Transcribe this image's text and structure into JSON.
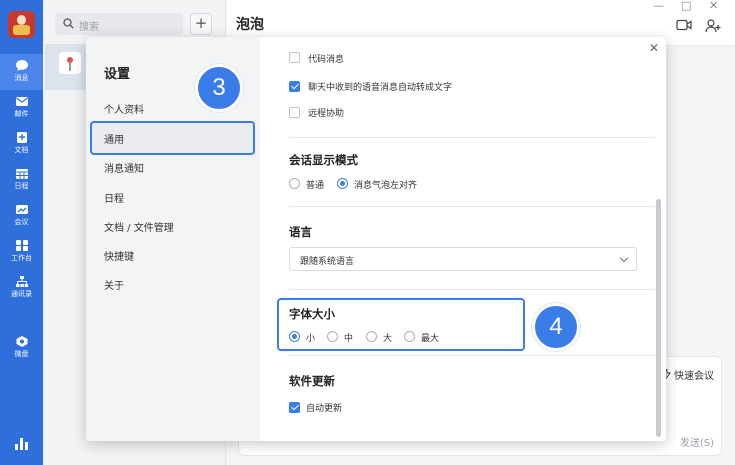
{
  "nav": {
    "items": [
      {
        "label": "消息",
        "icon": "chat-bubble-icon"
      },
      {
        "label": "邮件",
        "icon": "mail-icon"
      },
      {
        "label": "文档",
        "icon": "document-icon"
      },
      {
        "label": "日程",
        "icon": "calendar-icon"
      },
      {
        "label": "会议",
        "icon": "meeting-icon"
      },
      {
        "label": "工作台",
        "icon": "workbench-icon"
      },
      {
        "label": "通讯录",
        "icon": "contacts-icon"
      },
      {
        "label": "微盘",
        "icon": "drive-icon"
      }
    ]
  },
  "search": {
    "placeholder": "搜索"
  },
  "chat": {
    "title": "泡泡"
  },
  "compose": {
    "quick_meeting": "快速会议",
    "send": "发送(S)"
  },
  "settings": {
    "title": "设置",
    "menu": [
      "个人资料",
      "通用",
      "消息通知",
      "日程",
      "文档 / 文件管理",
      "快捷键",
      "关于"
    ],
    "selected": "通用",
    "top_partial_option": "代码消息",
    "voice_to_text": "聊天中收到的语音消息自动转成文字",
    "remote_assist": "远程协助",
    "display_mode": {
      "title": "会话显示模式",
      "options": [
        "普通",
        "消息气泡左对齐"
      ],
      "selected": "消息气泡左对齐"
    },
    "language": {
      "title": "语言",
      "value": "跟随系统语言"
    },
    "font_size": {
      "title": "字体大小",
      "options": [
        "小",
        "中",
        "大",
        "最大"
      ],
      "selected": "小"
    },
    "update": {
      "title": "软件更新",
      "auto_update": "自动更新"
    }
  },
  "steps": {
    "step3": "3",
    "step4": "4"
  },
  "colors": {
    "nav": "#2f6fdc",
    "accent": "#3b7de8"
  }
}
